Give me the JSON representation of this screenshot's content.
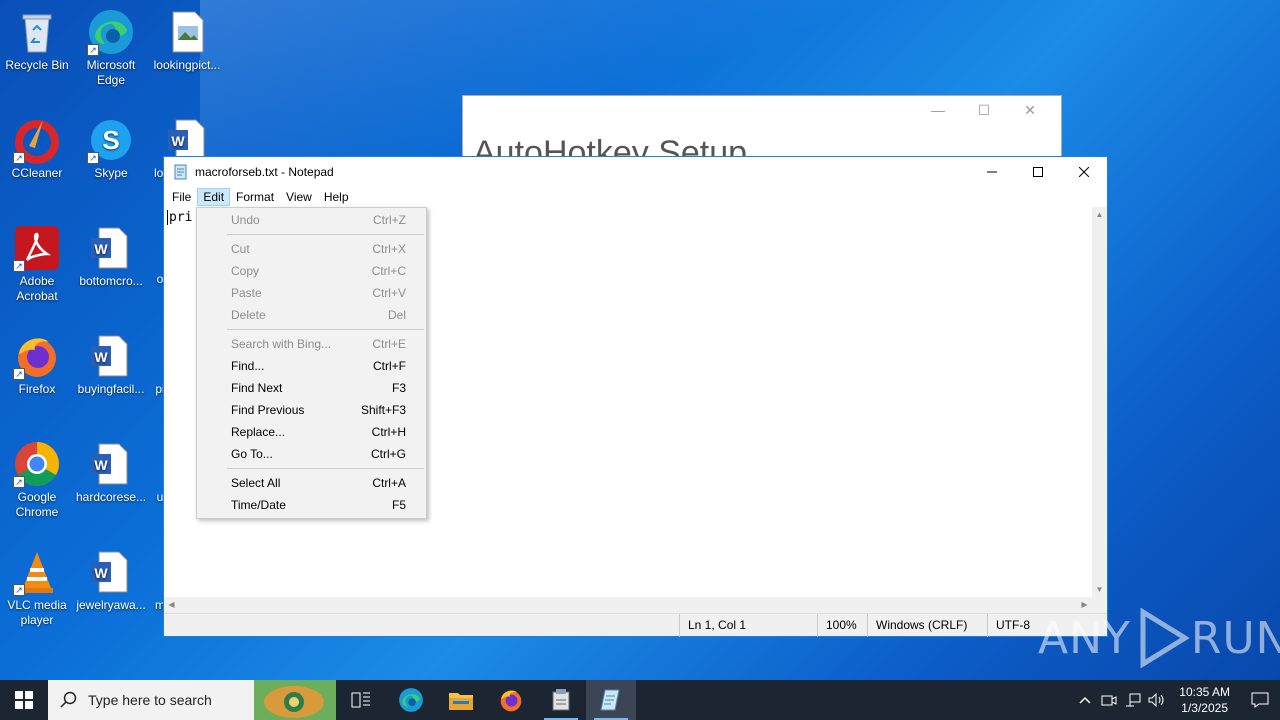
{
  "desktop": {
    "icons": [
      {
        "label": "Recycle Bin"
      },
      {
        "label": "Microsoft Edge"
      },
      {
        "label": "lookingpict..."
      },
      {
        "label": "CCleaner"
      },
      {
        "label": "Skype"
      },
      {
        "label": "lo"
      },
      {
        "label": "Adobe Acrobat"
      },
      {
        "label": "bottomcro..."
      },
      {
        "label": "o"
      },
      {
        "label": "Firefox"
      },
      {
        "label": "buyingfacil..."
      },
      {
        "label": "pi"
      },
      {
        "label": "Google Chrome"
      },
      {
        "label": "hardcorese..."
      },
      {
        "label": "u"
      },
      {
        "label": "VLC media player"
      },
      {
        "label": "jewelryawa..."
      },
      {
        "label": "m"
      }
    ]
  },
  "ahk_window": {
    "title": "AutoHotkey Setup"
  },
  "notepad": {
    "title": "macroforseb.txt - Notepad",
    "menu": [
      "File",
      "Edit",
      "Format",
      "View",
      "Help"
    ],
    "content": "pri",
    "status": {
      "position": "Ln 1, Col 1",
      "zoom": "100%",
      "line_ending": "Windows (CRLF)",
      "encoding": "UTF-8"
    }
  },
  "edit_menu": {
    "groups": [
      [
        {
          "label": "Undo",
          "shortcut": "Ctrl+Z",
          "enabled": false
        }
      ],
      [
        {
          "label": "Cut",
          "shortcut": "Ctrl+X",
          "enabled": false
        },
        {
          "label": "Copy",
          "shortcut": "Ctrl+C",
          "enabled": false
        },
        {
          "label": "Paste",
          "shortcut": "Ctrl+V",
          "enabled": false
        },
        {
          "label": "Delete",
          "shortcut": "Del",
          "enabled": false
        }
      ],
      [
        {
          "label": "Search with Bing...",
          "shortcut": "Ctrl+E",
          "enabled": false
        },
        {
          "label": "Find...",
          "shortcut": "Ctrl+F",
          "enabled": true
        },
        {
          "label": "Find Next",
          "shortcut": "F3",
          "enabled": true
        },
        {
          "label": "Find Previous",
          "shortcut": "Shift+F3",
          "enabled": true
        },
        {
          "label": "Replace...",
          "shortcut": "Ctrl+H",
          "enabled": true
        },
        {
          "label": "Go To...",
          "shortcut": "Ctrl+G",
          "enabled": true
        }
      ],
      [
        {
          "label": "Select All",
          "shortcut": "Ctrl+A",
          "enabled": true
        },
        {
          "label": "Time/Date",
          "shortcut": "F5",
          "enabled": true
        }
      ]
    ]
  },
  "taskbar": {
    "search_placeholder": "Type here to search",
    "clock_time": "10:35 AM",
    "clock_date": "1/3/2025"
  },
  "watermark": {
    "left": "ANY",
    "right": "RUN"
  },
  "colors": {
    "accent": "#1883d7",
    "menu_highlight": "#cce8ff",
    "taskbar": "#1c2633"
  }
}
